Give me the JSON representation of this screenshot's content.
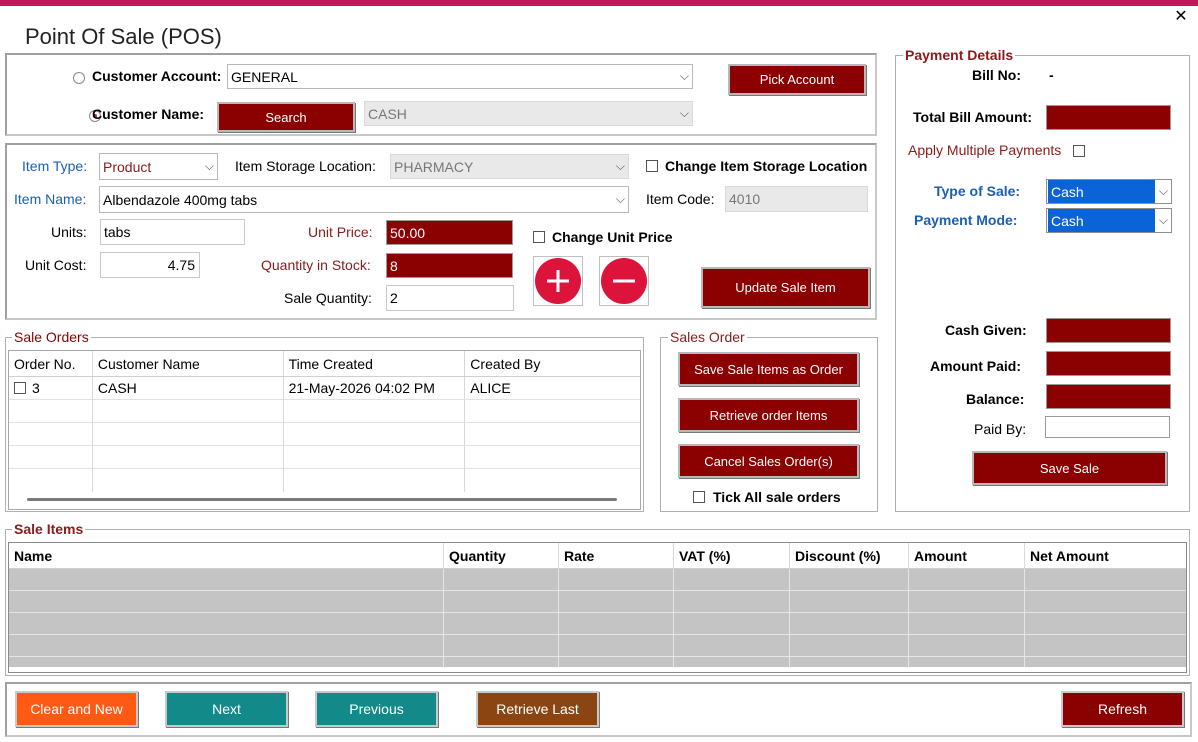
{
  "window": {
    "title": "Point Of Sale (POS)",
    "close_glyph": "✕"
  },
  "customer": {
    "account_label": "Customer Account:",
    "account_value": "GENERAL",
    "name_label": "Customer Name:",
    "search_label": "Search",
    "name_value": "CASH",
    "pick_account_label": "Pick Account",
    "selected_radio": "customer-name"
  },
  "item": {
    "type_label": "Item Type:",
    "type_value": "Product",
    "storage_label": "Item Storage Location:",
    "storage_value": "PHARMACY",
    "change_storage_label": "Change Item Storage Location",
    "name_label": "Item Name:",
    "name_value": "Albendazole 400mg tabs",
    "code_label": "Item Code:",
    "code_value": "4010",
    "units_label": "Units:",
    "units_value": "tabs",
    "unit_cost_label": "Unit Cost:",
    "unit_cost_value": "4.75",
    "unit_price_label": "Unit Price:",
    "unit_price_value": "50.00",
    "qty_stock_label": "Quantity in Stock:",
    "qty_stock_value": "8",
    "sale_qty_label": "Sale Quantity:",
    "sale_qty_value": "2",
    "change_price_label": "Change Unit Price",
    "update_label": "Update Sale Item",
    "plus_icon": "plus-circle",
    "minus_icon": "minus-circle"
  },
  "sale_orders": {
    "group_label": "Sale Orders",
    "columns": [
      "Order No.",
      "Customer Name",
      "Time Created",
      "Created By"
    ],
    "rows": [
      {
        "order_no": "3",
        "customer": "CASH",
        "time": "21-May-2026 04:02 PM",
        "created_by": "ALICE"
      }
    ]
  },
  "sales_order_actions": {
    "group_label": "Sales Order",
    "save_label": "Save Sale Items as Order",
    "retrieve_label": "Retrieve order Items",
    "cancel_label": "Cancel Sales Order(s)",
    "tick_all_label": "Tick All sale orders"
  },
  "payment": {
    "group_label": "Payment Details",
    "bill_no_label": "Bill No:",
    "bill_no_value": "-",
    "total_label": "Total Bill Amount:",
    "multi_label": "Apply Multiple Payments",
    "type_of_sale_label": "Type of Sale:",
    "type_of_sale_value": "Cash",
    "payment_mode_label": "Payment Mode:",
    "payment_mode_value": "Cash",
    "cash_given_label": "Cash Given:",
    "amount_paid_label": "Amount Paid:",
    "balance_label": "Balance:",
    "paid_by_label": "Paid By:",
    "save_sale_label": "Save Sale"
  },
  "sale_items": {
    "group_label": "Sale Items",
    "columns": [
      "Name",
      "Quantity",
      "Rate",
      "VAT (%)",
      "Discount (%)",
      "Amount",
      "Net Amount"
    ]
  },
  "footer": {
    "clear_label": "Clear and New",
    "next_label": "Next",
    "previous_label": "Previous",
    "retrieve_last_label": "Retrieve Last",
    "refresh_label": "Refresh"
  },
  "colors": {
    "accent_red": "#8b0000",
    "topbar": "#c2185b",
    "teal": "#138a8a",
    "orange": "#ff5a14",
    "brown": "#8b4513",
    "selection_blue": "#0b63d8"
  }
}
